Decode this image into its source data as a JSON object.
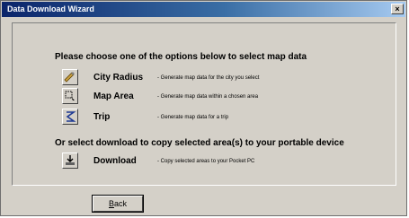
{
  "window": {
    "title": "Data Download Wizard",
    "close_glyph": "×"
  },
  "main": {
    "heading_map": "Please choose one of the options below to select map data",
    "options": [
      {
        "icon": "city-radius-icon",
        "label": "City Radius",
        "description": "- Generate map data for the city you select"
      },
      {
        "icon": "map-area-icon",
        "label": "Map Area",
        "description": "- Generate map data within a chosen area"
      },
      {
        "icon": "trip-icon",
        "label": "Trip",
        "description": "- Generate map data for a trip"
      }
    ],
    "heading_download": "Or select download to copy selected area(s) to your portable device",
    "download": {
      "icon": "download-icon",
      "label": "Download",
      "description": "- Copy selected areas to your Pocket PC"
    }
  },
  "footer": {
    "back_accel": "B",
    "back_rest": "ack"
  }
}
